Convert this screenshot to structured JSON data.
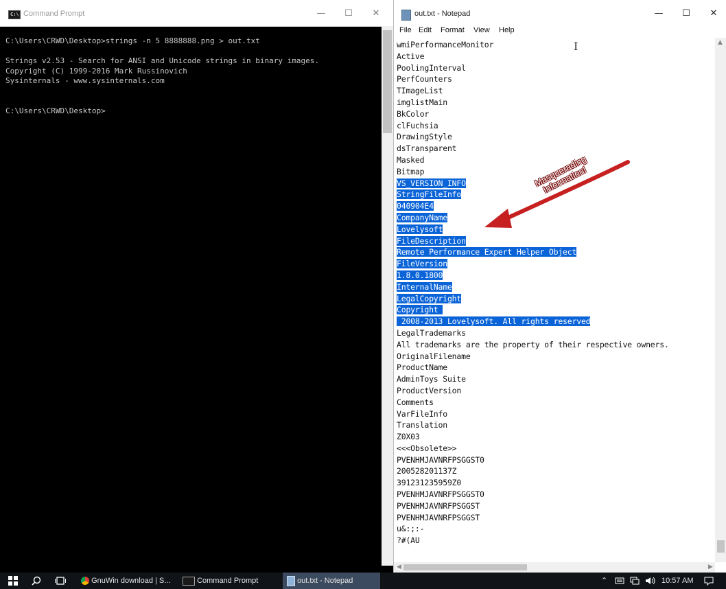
{
  "cmd": {
    "title": "Command Prompt",
    "icon": "cmd-icon",
    "console_lines": [
      "C:\\Users\\CRWD\\Desktop>strings -n 5 8888888.png > out.txt",
      "",
      "Strings v2.53 - Search for ANSI and Unicode strings in binary images.",
      "Copyright (C) 1999-2016 Mark Russinovich",
      "Sysinternals - www.sysinternals.com",
      "",
      "",
      "C:\\Users\\CRWD\\Desktop>"
    ]
  },
  "notepad": {
    "title": "out.txt - Notepad",
    "menu": [
      "File",
      "Edit",
      "Format",
      "View",
      "Help"
    ],
    "lines": [
      {
        "text": "wmiPerformanceMonitor",
        "selected": false
      },
      {
        "text": "Active",
        "selected": false
      },
      {
        "text": "PoolingInterval",
        "selected": false
      },
      {
        "text": "PerfCounters",
        "selected": false
      },
      {
        "text": "TImageList",
        "selected": false
      },
      {
        "text": "imglistMain",
        "selected": false
      },
      {
        "text": "BkColor",
        "selected": false
      },
      {
        "text": "clFuchsia",
        "selected": false
      },
      {
        "text": "DrawingStyle",
        "selected": false
      },
      {
        "text": "dsTransparent",
        "selected": false
      },
      {
        "text": "Masked",
        "selected": false
      },
      {
        "text": "Bitmap",
        "selected": false
      },
      {
        "text": "VS_VERSION_INFO",
        "selected": true
      },
      {
        "text": "StringFileInfo",
        "selected": true
      },
      {
        "text": "040904E4",
        "selected": true
      },
      {
        "text": "CompanyName",
        "selected": true
      },
      {
        "text": "Lovelysoft",
        "selected": true
      },
      {
        "text": "FileDescription",
        "selected": true
      },
      {
        "text": "Remote Performance Expert Helper Object",
        "selected": true
      },
      {
        "text": "FileVersion",
        "selected": true
      },
      {
        "text": "1.8.0.1800",
        "selected": true
      },
      {
        "text": "InternalName",
        "selected": true
      },
      {
        "text": "LegalCopyright",
        "selected": true
      },
      {
        "text": "Copyright ",
        "selected": true
      },
      {
        "text": " 2008-2013 Lovelysoft. All rights reserved",
        "selected": true
      },
      {
        "text": "LegalTrademarks",
        "selected": false
      },
      {
        "text": "All trademarks are the property of their respective owners.",
        "selected": false
      },
      {
        "text": "OriginalFilename",
        "selected": false
      },
      {
        "text": "ProductName",
        "selected": false
      },
      {
        "text": "AdminToys Suite",
        "selected": false
      },
      {
        "text": "ProductVersion",
        "selected": false
      },
      {
        "text": "Comments",
        "selected": false
      },
      {
        "text": "VarFileInfo",
        "selected": false
      },
      {
        "text": "Translation",
        "selected": false
      },
      {
        "text": "Z0X03",
        "selected": false
      },
      {
        "text": "<<<Obsolete>>",
        "selected": false
      },
      {
        "text": "PVENHMJAVNRFPSGGST0",
        "selected": false
      },
      {
        "text": "200528201137Z",
        "selected": false
      },
      {
        "text": "391231235959Z0",
        "selected": false
      },
      {
        "text": "PVENHMJAVNRFPSGGST0",
        "selected": false
      },
      {
        "text": "PVENHMJAVNRFPSGGST",
        "selected": false
      },
      {
        "text": "PVENHMJAVNRFPSGGST",
        "selected": false
      },
      {
        "text": "u&:;:-",
        "selected": false
      },
      {
        "text": "?#(AU",
        "selected": false
      }
    ]
  },
  "annotation": {
    "line1": "Masquerading",
    "line2": "Information!",
    "color": "#c62020"
  },
  "window_controls": {
    "minimize": "—",
    "maximize": "☐",
    "close": "✕"
  },
  "taskbar": {
    "items": [
      {
        "label": "GnuWin download | S...",
        "icon": "chrome-icon",
        "active": false
      },
      {
        "label": "Command Prompt",
        "icon": "cmd-icon",
        "active": false
      },
      {
        "label": "out.txt - Notepad",
        "icon": "notepad-icon",
        "active": true
      }
    ],
    "clock": "10:57 AM",
    "accent": "#3b4a5e"
  }
}
